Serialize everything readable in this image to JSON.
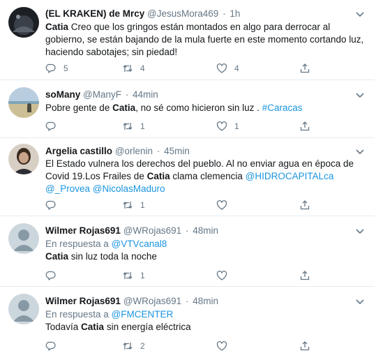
{
  "tweets": [
    {
      "name": "(EL KRAKEN) de Mrcy",
      "handle": "@JesusMora469",
      "dot": "·",
      "time": "1h",
      "reply_prefix": "",
      "reply_handle": "",
      "body": [
        {
          "text": "Catia",
          "bold": true
        },
        {
          "text": " Creo que los gringos están montados en algo para derrocar al gobierno, se están bajando de la mula fuerte en este momento cortando luz, haciendo sabotajes; sin piedad!"
        }
      ],
      "replies": "5",
      "retweets": "4",
      "likes": "4",
      "avatar": "dark-landscape"
    },
    {
      "name": "soMany",
      "handle": "@ManyF",
      "dot": "·",
      "time": "44min",
      "reply_prefix": "",
      "reply_handle": "",
      "body": [
        {
          "text": "Pobre gente de "
        },
        {
          "text": "Catia",
          "bold": true
        },
        {
          "text": ", no sé como hicieron sin luz . "
        },
        {
          "text": "#Caracas",
          "link": true
        }
      ],
      "replies": "",
      "retweets": "1",
      "likes": "1",
      "avatar": "beach"
    },
    {
      "name": "Argelia castillo",
      "handle": "@orlenin",
      "dot": "·",
      "time": "45min",
      "reply_prefix": "",
      "reply_handle": "",
      "body": [
        {
          "text": "El Estado vulnera los derechos del pueblo. Al no enviar agua en época de Covid 19.Los Frailes de "
        },
        {
          "text": "Catia",
          "bold": true
        },
        {
          "text": " clama clemencia      "
        },
        {
          "text": "@HIDROCAPITALca",
          "link": true
        },
        {
          "text": " "
        },
        {
          "text": "@_Provea",
          "link": true
        },
        {
          "text": " "
        },
        {
          "text": "@NicolasMaduro",
          "link": true
        }
      ],
      "replies": "",
      "retweets": "1",
      "likes": "",
      "avatar": "woman"
    },
    {
      "name": "Wilmer Rojas691",
      "handle": "@WRojas691",
      "dot": "·",
      "time": "48min",
      "reply_prefix": "En respuesta a ",
      "reply_handle": "@VTVcanal8",
      "body": [
        {
          "text": "Catia",
          "bold": true
        },
        {
          "text": " sin luz toda la noche"
        }
      ],
      "replies": "",
      "retweets": "1",
      "likes": "",
      "avatar": "default"
    },
    {
      "name": "Wilmer Rojas691",
      "handle": "@WRojas691",
      "dot": "·",
      "time": "48min",
      "reply_prefix": "En respuesta a ",
      "reply_handle": "@FMCENTER",
      "body": [
        {
          "text": "Todavía "
        },
        {
          "text": "Catia",
          "bold": true
        },
        {
          "text": " sin energía eléctrica"
        }
      ],
      "replies": "",
      "retweets": "2",
      "likes": "",
      "avatar": "default"
    }
  ],
  "icons": {
    "reply": "reply-icon",
    "retweet": "retweet-icon",
    "like": "heart-icon",
    "share": "share-icon",
    "caret": "chevron-down-icon"
  },
  "colors": {
    "text": "#14171a",
    "muted": "#657786",
    "link": "#1b95e0",
    "divider": "#e6ecf0"
  }
}
